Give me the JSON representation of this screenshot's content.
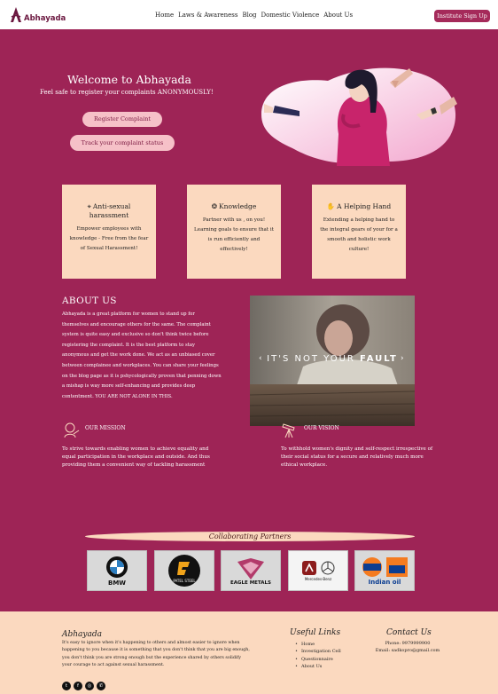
{
  "nav": {
    "logo_text": "Abhayada",
    "links": [
      "Home",
      "Laws & Awareness",
      "Blog",
      "Domestic Violence",
      "About Us"
    ],
    "signup_label": "Institute Sign Up"
  },
  "hero": {
    "title": "Welcome to Abhayada",
    "subtitle": "Feel safe to register your complaints ANONYMOUSLY!",
    "register_label": "Register Complaint",
    "track_label": "Track your complaint status"
  },
  "cards": [
    {
      "icon": "map-pin-icon",
      "title": "Anti-sexual harassment",
      "text": "Empower employees with knowledge - Free from the fear of Sexual Harassment!"
    },
    {
      "icon": "brain-icon",
      "title": "Knowledge",
      "text": "Partner with us , on you! Learning goals to ensure that it is run efficiently and effectively!"
    },
    {
      "icon": "handshake-icon",
      "title": "A Helping Hand",
      "text": "Extending a helping hand to the integral gears of your for a smooth and holistic work culture!"
    }
  ],
  "about": {
    "heading": "ABOUT US",
    "text": "Abhayada is a great platform for women to stand up for themselves and encourage others for the same. The complaint system is quite easy and exclusive so don't think twice before registering the complaint. It is the best platform to stay anonymous and get the work done. We act as an unbiased cover between complainee and workplaces. You can share your feelings on the blog page as it is pshycologically proven that penning down a mishap is way more self-enhancing and provides deep contentment. YOU ARE NOT ALONE IN THIS.",
    "image_caption_normal": "IT'S NOT YOUR ",
    "image_caption_bold": "FAULT"
  },
  "mission": {
    "title": "OUR MISSION",
    "text": "To strive towards enabling women to achieve equality and equal participation in the workplace and outside. And thus providing them a convenient way of tackling harassment"
  },
  "vision": {
    "title": "OUR VISION",
    "text": "To withhold women's dignity and self-respect irrespective of their social status for a secure and relatively much more ethical workplace."
  },
  "partners": {
    "title": "Collaborating Partners",
    "logos": [
      {
        "name": "BMW",
        "label": "BMW"
      },
      {
        "name": "Patel Steel",
        "label": "PATEL STEEL"
      },
      {
        "name": "Eagle Metals",
        "label": "EAGLE METALS"
      },
      {
        "name": "Mercedes-Benz",
        "label": "Mercedes-Benz"
      },
      {
        "name": "Indian Oil",
        "label": "Indian oil"
      }
    ]
  },
  "footer": {
    "brand": "Abhayada",
    "description": "It's easy to ignore when it's happening to others and almost easier to ignore when happening to you because it is something that you don't think that you are big enough, you don't think you are strong enough but the experience shared by others solidify your courage to act against sexual harassment.",
    "links_heading": "Useful Links",
    "links": [
      "Home",
      "Investigation Cell",
      "Questionnaire",
      "About Us"
    ],
    "contact_heading": "Contact Us",
    "phone": "Phone: 9979999900",
    "email": "Email: sadkopro@gmail.com"
  },
  "colors": {
    "brand": "#9e2456",
    "accent_peach": "#fbd9bf",
    "pill_pink": "#f6c1c8",
    "signup": "#a52a5a"
  }
}
